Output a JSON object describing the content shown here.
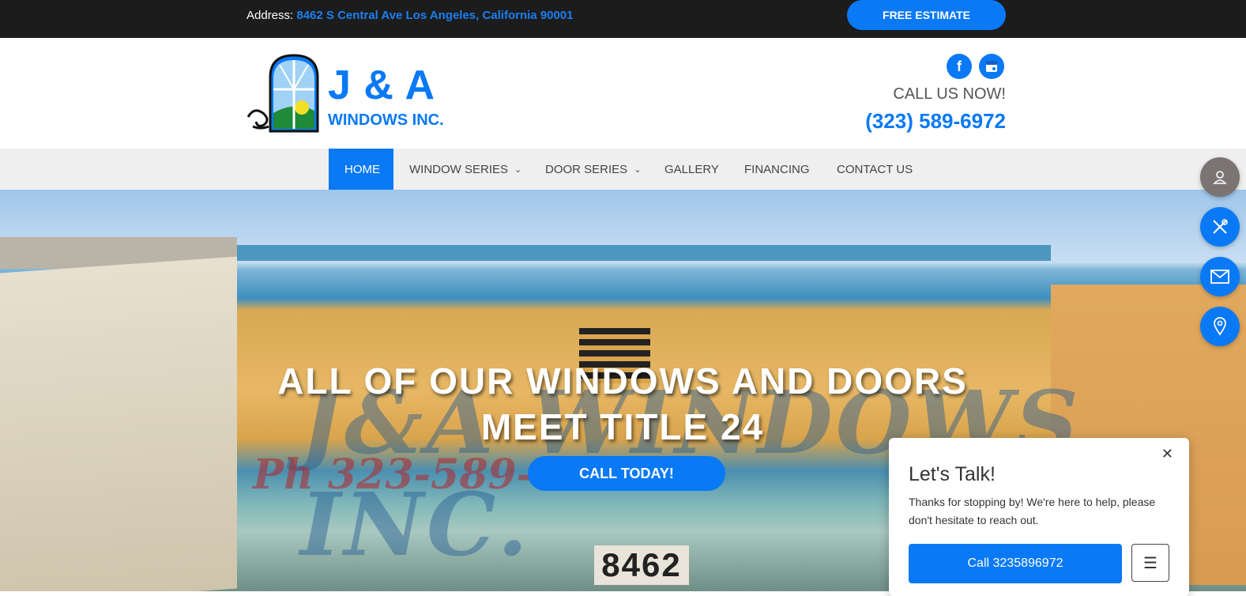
{
  "topbar": {
    "address_label": "Address:",
    "address_value": "8462 S Central Ave Los Angeles, California 90001",
    "estimate_button": "FREE ESTIMATE"
  },
  "header": {
    "logo_big": "J & A",
    "logo_small": "WINDOWS INC.",
    "call_now": "CALL US NOW!",
    "phone": "(323) 589-6972",
    "social": [
      "facebook-icon",
      "google-business-icon"
    ]
  },
  "nav": {
    "items": [
      {
        "label": "HOME",
        "active": true
      },
      {
        "label": "WINDOW SERIES",
        "dropdown": true
      },
      {
        "label": "DOOR SERIES",
        "dropdown": true
      },
      {
        "label": "GALLERY"
      },
      {
        "label": "FINANCING"
      },
      {
        "label": "CONTACT US"
      }
    ]
  },
  "hero": {
    "title_line1": "ALL OF OUR WINDOWS AND DOORS",
    "title_line2": "MEET TITLE 24",
    "cta": "CALL TODAY!",
    "building_number": "8462",
    "sign_text": "J&A WINDOWS INC.",
    "sign_phone": "Ph 323-589-6972"
  },
  "floating": {
    "buttons": [
      {
        "icon": "user-icon",
        "color": "#7a7574"
      },
      {
        "icon": "tools-icon",
        "color": "#0a79f5"
      },
      {
        "icon": "mail-icon",
        "color": "#0a79f5"
      },
      {
        "icon": "location-icon",
        "color": "#0a79f5"
      }
    ]
  },
  "chat": {
    "title": "Let's Talk!",
    "body": "Thanks for stopping by! We're here to help, please don't hesitate to reach out.",
    "call_button": "Call 3235896972"
  },
  "colors": {
    "accent": "#0a79f5",
    "topbar": "#1c1c1c",
    "nav_bg": "#efefef"
  }
}
